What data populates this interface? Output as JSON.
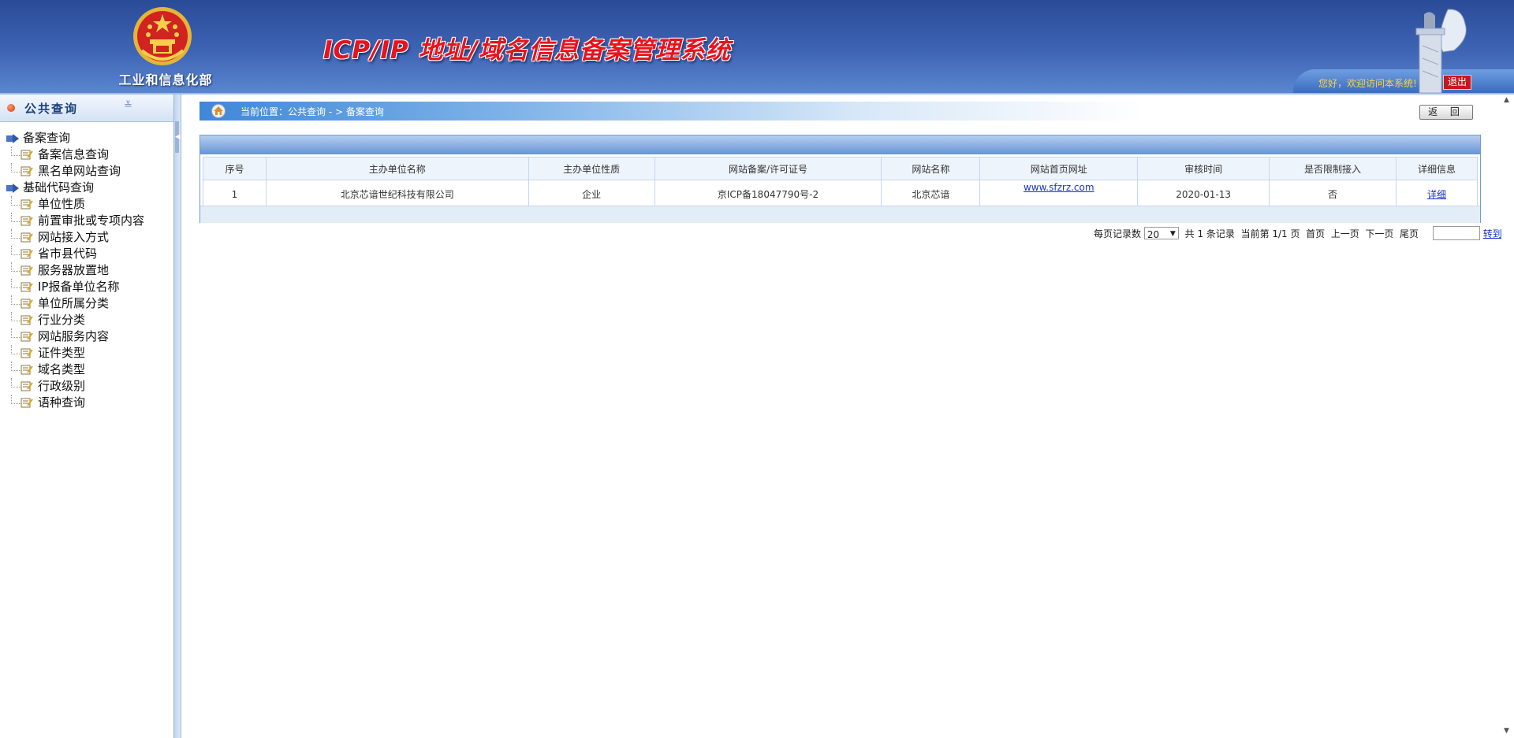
{
  "header": {
    "ministry": "工业和信息化部",
    "title": "ICP/IP 地址/域名信息备案管理系统",
    "welcome": "您好，欢迎访问本系统!",
    "logout": "退出"
  },
  "sidebar": {
    "title": "公共查询",
    "groups": [
      {
        "label": "备案查询",
        "items": [
          "备案信息查询",
          "黑名单网站查询"
        ]
      },
      {
        "label": "基础代码查询",
        "items": [
          "单位性质",
          "前置审批或专项内容",
          "网站接入方式",
          "省市县代码",
          "服务器放置地",
          "IP报备单位名称",
          "单位所属分类",
          "行业分类",
          "网站服务内容",
          "证件类型",
          "域名类型",
          "行政级别",
          "语种查询"
        ]
      }
    ]
  },
  "breadcrumb": {
    "text": "当前位置：公共查询   - >  备案查询"
  },
  "back_button": "返 回",
  "table": {
    "headers": [
      "序号",
      "主办单位名称",
      "主办单位性质",
      "网站备案/许可证号",
      "网站名称",
      "网站首页网址",
      "审核时间",
      "是否限制接入",
      "详细信息"
    ],
    "rows": [
      {
        "index": "1",
        "org": "北京芯谙世纪科技有限公司",
        "org_type": "企业",
        "license": "京ICP备18047790号-2",
        "site_name": "北京芯谙",
        "url": "www.sfzrz.com",
        "date": "2020-01-13",
        "restricted": "否",
        "detail": "详细"
      }
    ]
  },
  "pager": {
    "per_page_label": "每页记录数",
    "per_page_value": "20",
    "summary": "共 1 条记录  当前第 1/1 页  首页  上一页  下一页  尾页",
    "jump": "转到"
  }
}
